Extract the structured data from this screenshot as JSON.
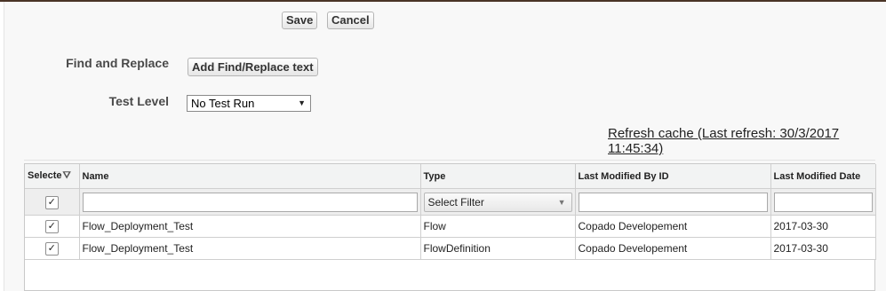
{
  "toolbar": {
    "save_label": "Save",
    "cancel_label": "Cancel"
  },
  "find_replace": {
    "label": "Find and Replace",
    "button_label": "Add Find/Replace text"
  },
  "test_level": {
    "label": "Test Level",
    "selected": "No Test Run",
    "arrow": "▼"
  },
  "refresh": {
    "text": "Refresh cache (Last refresh: 30/3/2017 11:45:34)"
  },
  "grid": {
    "columns": [
      "Selected",
      "Name",
      "Type",
      "Last Modified By ID",
      "Last Modified Date"
    ],
    "selected_header_short": "Selecte",
    "filter": {
      "type_placeholder": "Select Filter",
      "select_all_check": "✓"
    },
    "rows": [
      {
        "check": "✓",
        "name": "Flow_Deployment_Test",
        "type": "Flow",
        "modified_by": "Copado Developement",
        "modified_date": "2017-03-30"
      },
      {
        "check": "✓",
        "name": "Flow_Deployment_Test",
        "type": "FlowDefinition",
        "modified_by": "Copado Developement",
        "modified_date": "2017-03-30"
      }
    ]
  }
}
